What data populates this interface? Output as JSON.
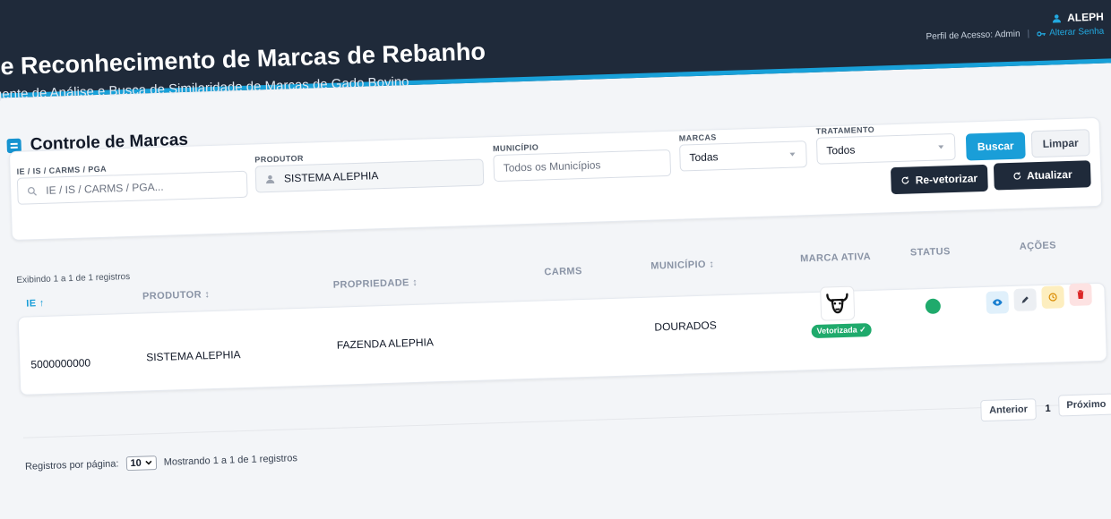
{
  "header": {
    "title": "le Reconhecimento de Marcas de Rebanho",
    "subtitle": "gente de Análise e Busca de Similaridade de Marcas de Gado Bovino",
    "user": "ALEPH",
    "access_profile": "Perfil de Acesso: Admin",
    "change_password": "Alterar Senha"
  },
  "section": {
    "title": "Controle de Marcas"
  },
  "filters": {
    "ie": {
      "label": "IE / IS / CARMS / PGA",
      "placeholder": "IE / IS / CARMS / PGA..."
    },
    "produtor": {
      "label": "PRODUTOR",
      "value": "SISTEMA ALEPHIA"
    },
    "municipio": {
      "label": "MUNICÍPIO",
      "placeholder": "Todos os Municípios"
    },
    "marcas": {
      "label": "MARCAS",
      "value": "Todas"
    },
    "tratamento": {
      "label": "TRATAMENTO",
      "value": "Todos"
    },
    "search_button": "Buscar",
    "clear_button": "Limpar",
    "revectorize_button": "Re-vetorizar",
    "refresh_button": "Atualizar"
  },
  "table": {
    "showing_text": "Exibindo 1 a 1 de 1 registros",
    "columns": {
      "ie": "IE",
      "produtor": "PRODUTOR",
      "propriedade": "PROPRIEDADE",
      "carms": "CARMS",
      "municipio": "MUNICÍPIO",
      "marca_ativa": "MARCA ATIVA",
      "status": "STATUS",
      "acoes": "AÇÕES"
    },
    "rows": [
      {
        "ie": "5000000000",
        "produtor": "SISTEMA ALEPHIA",
        "propriedade": "FAZENDA ALEPHIA",
        "carms": "",
        "municipio": "DOURADOS",
        "marca_badge": "Vetorizada",
        "status": "active"
      }
    ]
  },
  "footer": {
    "per_page_label": "Registros por página:",
    "per_page_value": "10",
    "showing_text": "Mostrando 1 a 1 de 1 registros",
    "prev_button": "Anterior",
    "current_page": "1",
    "next_button": "Próximo"
  },
  "colors": {
    "header_bg": "#1f2a3a",
    "accent": "#1a9ed8",
    "success": "#1faa6c"
  }
}
